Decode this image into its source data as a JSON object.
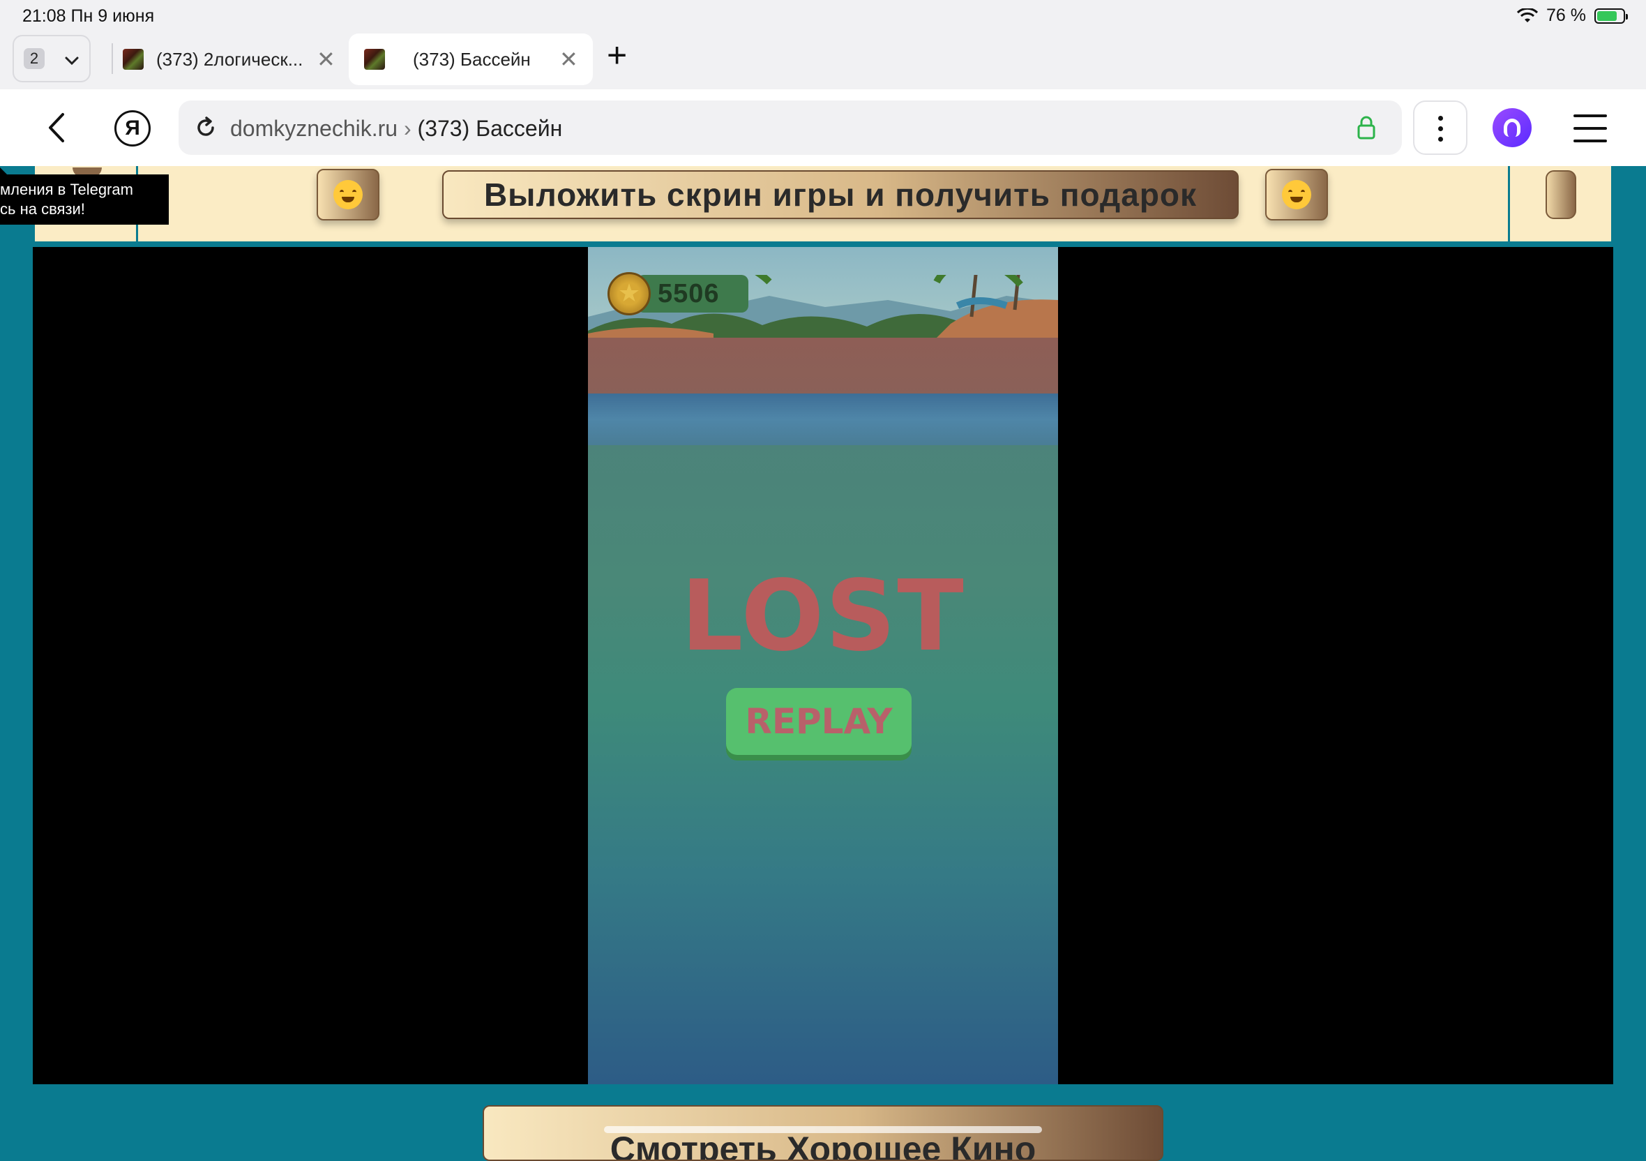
{
  "status": {
    "time_date": "21:08   Пн 9 июня",
    "battery": "76 %"
  },
  "tabs": {
    "count": "2",
    "items": [
      {
        "title": "(373) 2логическ..."
      },
      {
        "title": "(373) Бассейн"
      }
    ]
  },
  "toolbar": {
    "domain": "domkyznechik.ru",
    "separator": " › ",
    "page_title": "(373) Бассейн",
    "yandex_logo": "Я"
  },
  "tooltip": {
    "line1": "мления в Telegram",
    "line2": "сь на связи!"
  },
  "banner": {
    "share_label": "Выложить скрин игры и получить подарок"
  },
  "game": {
    "coins": "5506",
    "result": "LOST",
    "replay_label": "REPLAY"
  },
  "footer": {
    "watch_label": "Смотреть Хорошее Кино"
  },
  "colors": {
    "page_bg": "#0a7b90",
    "banner_bg": "#fbecc5",
    "lost_text": "#b85c5c",
    "replay_bg": "#56c06e"
  },
  "icons": [
    "wifi-icon",
    "battery-icon",
    "chevron-down-icon",
    "close-icon",
    "plus-icon",
    "back-icon",
    "reload-icon",
    "lock-icon",
    "kebab-icon",
    "alice-icon",
    "menu-icon",
    "emoji-icon",
    "coin-icon"
  ]
}
